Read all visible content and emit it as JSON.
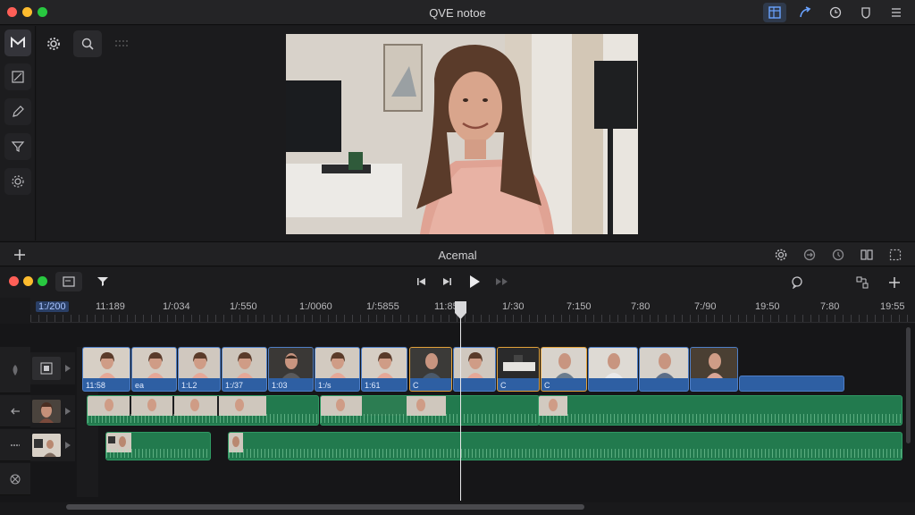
{
  "window": {
    "title": "QVE notoe"
  },
  "midbar": {
    "title": "Acemal"
  },
  "colors": {
    "close": "#ff5f57",
    "minimize": "#febc2e",
    "zoom": "#28c840",
    "clip_blue": "#2e5fa3",
    "clip_green": "#227a4e",
    "accent": "#4f8cff"
  },
  "titlebar_icons": [
    "grid-icon",
    "arrow-curve-icon",
    "clock-icon",
    "shield-icon",
    "menu-icon"
  ],
  "rail_icons": [
    "magnet-icon",
    "transform-icon",
    "pen-icon",
    "filter-icon",
    "gear-badge-icon"
  ],
  "ruler": {
    "labels": [
      "1:/200",
      "11:189",
      "1/:034",
      "1/:550",
      "1:/0060",
      "1/:5855",
      "11:85",
      "1/:30",
      "7:150",
      "7:80",
      "7:/90",
      "19:50",
      "7:80",
      "19:55"
    ]
  },
  "clips_v1": [
    "11:58",
    "ea",
    "1:L2",
    "1:/37",
    "1:03",
    "1:/s",
    "1:61",
    "",
    "",
    "",
    "",
    "",
    "",
    ""
  ],
  "clips_v1_labels": [
    "C",
    "C",
    "C"
  ]
}
